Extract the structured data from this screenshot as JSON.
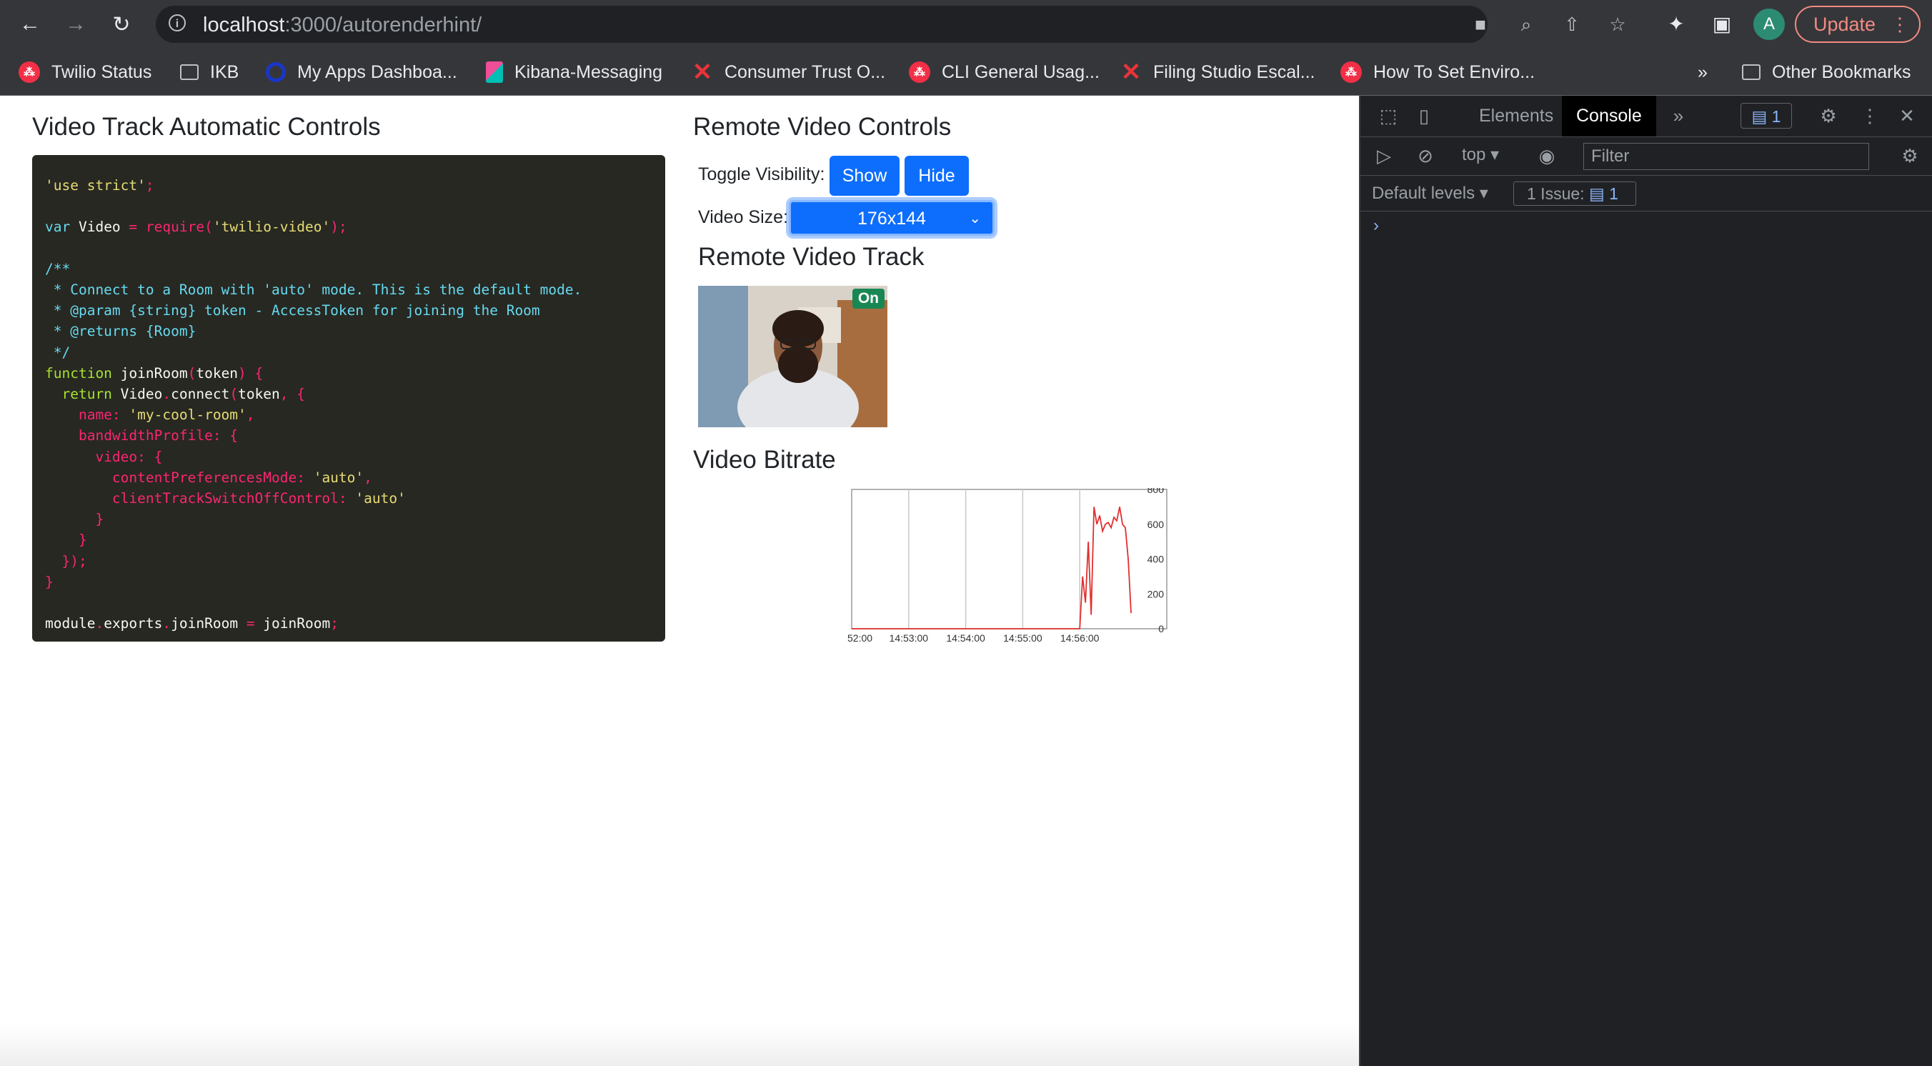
{
  "browser": {
    "url_host": "localhost",
    "url_path": ":3000/autorenderhint/",
    "update_label": "Update",
    "avatar_letter": "A",
    "bookmarks": [
      {
        "label": "Twilio Status",
        "icon": "twilio-icon"
      },
      {
        "label": "IKB",
        "icon": "folder-icon"
      },
      {
        "label": "My Apps Dashboa...",
        "icon": "okta-icon"
      },
      {
        "label": "Kibana-Messaging",
        "icon": "kibana-icon"
      },
      {
        "label": "Consumer Trust O...",
        "icon": "red-x-icon"
      },
      {
        "label": "CLI General Usag...",
        "icon": "twilio-icon"
      },
      {
        "label": "Filing Studio Escal...",
        "icon": "red-x-icon"
      },
      {
        "label": "How To Set Enviro...",
        "icon": "twilio-icon"
      }
    ],
    "overflow_label": "»",
    "other_bookmarks": "Other Bookmarks"
  },
  "left": {
    "title": "Video Track Automatic Controls"
  },
  "right": {
    "controls_title": "Remote Video Controls",
    "toggle_label": "Toggle Visibility:",
    "show_label": "Show",
    "hide_label": "Hide",
    "size_label": "Video Size:",
    "size_value": "176x144",
    "track_title": "Remote Video Track",
    "badge": "On",
    "bitrate_title": "Video Bitrate"
  },
  "chart_data": {
    "type": "line",
    "title": "",
    "xlabel": "",
    "ylabel": "",
    "x_ticks": [
      "52:00",
      "14:53:00",
      "14:54:00",
      "14:55:00",
      "14:56:00"
    ],
    "y_ticks": [
      0,
      200,
      400,
      600,
      800
    ],
    "ylim": [
      0,
      800
    ],
    "grid": true,
    "color": "#e03030",
    "series": [
      {
        "x": [
          0,
          0.5,
          1,
          1.5,
          2,
          2.5,
          3,
          3.5,
          4,
          4.05,
          4.1,
          4.15,
          4.2,
          4.25,
          4.3,
          4.35,
          4.4,
          4.45,
          4.5,
          4.55,
          4.6,
          4.65,
          4.7,
          4.75,
          4.8,
          4.85,
          4.9
        ],
        "y": [
          0,
          0,
          0,
          0,
          0,
          0,
          0,
          0,
          0,
          300,
          150,
          500,
          80,
          700,
          600,
          650,
          560,
          600,
          610,
          580,
          640,
          620,
          700,
          600,
          580,
          400,
          90
        ]
      }
    ]
  },
  "devtools": {
    "tabs": [
      "Elements",
      "Console"
    ],
    "active_tab": "Console",
    "issues_count": "1",
    "context": "top",
    "filter_placeholder": "Filter",
    "levels": "Default levels",
    "issue_chip": "1 Issue:",
    "issue_chip_count": "1",
    "prompt": "›"
  }
}
